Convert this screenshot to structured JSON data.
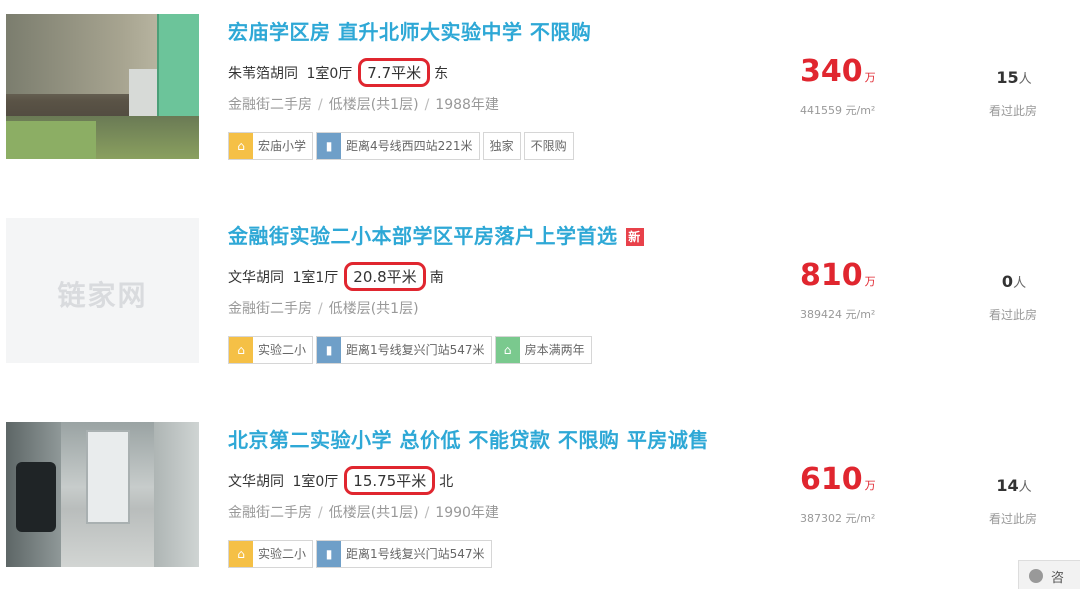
{
  "listings": [
    {
      "title": "宏庙学区房 直升北师大实验中学 不限购",
      "is_new": false,
      "address": "朱苇箔胡同",
      "layout": "1室0厅",
      "area": "7.7平米",
      "orientation": "东",
      "district": "金融街二手房",
      "floor": "低楼层(共1层)",
      "year": "1988年建",
      "tags": [
        {
          "icon": "school-icon",
          "text": "宏庙小学"
        },
        {
          "icon": "subway-icon",
          "text": "距离4号线西四站221米"
        },
        {
          "icon": "",
          "text": "独家"
        },
        {
          "icon": "",
          "text": "不限购"
        }
      ],
      "price": "340",
      "price_unit": "万",
      "unit_price": "441559 元/m²",
      "views": "15",
      "views_unit": "人",
      "views_label": "看过此房"
    },
    {
      "title": "金融街实验二小本部学区平房落户上学首选",
      "is_new": true,
      "new_label": "新",
      "address": "文华胡同",
      "layout": "1室1厅",
      "area": "20.8平米",
      "orientation": "南",
      "district": "金融街二手房",
      "floor": "低楼层(共1层)",
      "year": "",
      "watermark": "链家网",
      "tags": [
        {
          "icon": "school-icon",
          "text": "实验二小"
        },
        {
          "icon": "subway-icon",
          "text": "距离1号线复兴门站547米"
        },
        {
          "icon": "home-icon",
          "text": "房本满两年"
        }
      ],
      "price": "810",
      "price_unit": "万",
      "unit_price": "389424 元/m²",
      "views": "0",
      "views_unit": "人",
      "views_label": "看过此房"
    },
    {
      "title": "北京第二实验小学 总价低 不能贷款 不限购 平房诚售",
      "is_new": false,
      "address": "文华胡同",
      "layout": "1室0厅",
      "area": "15.75平米",
      "orientation": "北",
      "district": "金融街二手房",
      "floor": "低楼层(共1层)",
      "year": "1990年建",
      "tags": [
        {
          "icon": "school-icon",
          "text": "实验二小"
        },
        {
          "icon": "subway-icon",
          "text": "距离1号线复兴门站547米"
        }
      ],
      "price": "610",
      "price_unit": "万",
      "unit_price": "387302 元/m²",
      "views": "14",
      "views_unit": "人",
      "views_label": "看过此房"
    }
  ],
  "corner": {
    "label": "咨"
  },
  "colors": {
    "title": "#2ea8d6",
    "price": "#e0262f",
    "highlight": "#e0262f"
  }
}
